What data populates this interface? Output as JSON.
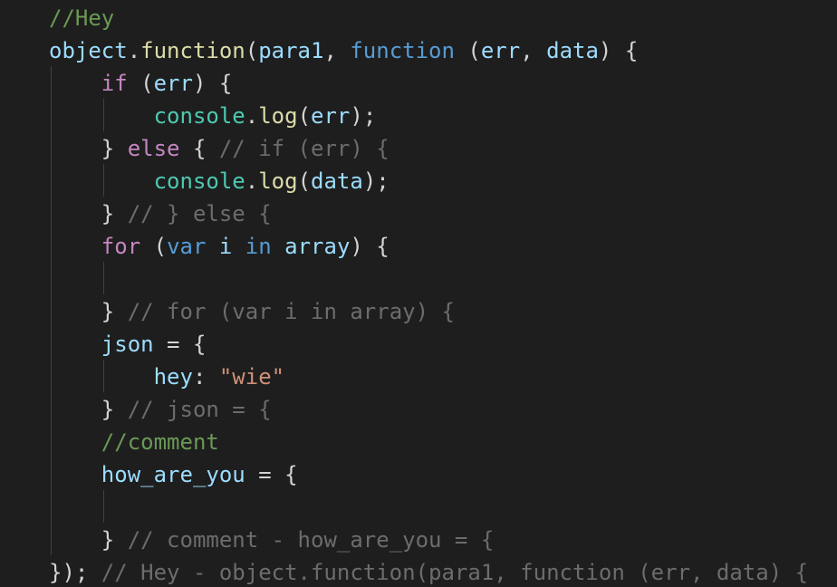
{
  "editor": {
    "lines": [
      {
        "tokens": [
          {
            "t": "//Hey",
            "c": "comment"
          }
        ]
      },
      {
        "tokens": [
          {
            "t": "object",
            "c": "variable"
          },
          {
            "t": ".",
            "c": "default"
          },
          {
            "t": "function",
            "c": "function"
          },
          {
            "t": "(",
            "c": "default"
          },
          {
            "t": "para1",
            "c": "variable"
          },
          {
            "t": ", ",
            "c": "default"
          },
          {
            "t": "function",
            "c": "keyword"
          },
          {
            "t": " (",
            "c": "default"
          },
          {
            "t": "err",
            "c": "variable"
          },
          {
            "t": ", ",
            "c": "default"
          },
          {
            "t": "data",
            "c": "variable"
          },
          {
            "t": ") {",
            "c": "default"
          }
        ]
      },
      {
        "tokens": [
          {
            "t": "    ",
            "c": "default"
          },
          {
            "t": "if",
            "c": "control"
          },
          {
            "t": " (",
            "c": "default"
          },
          {
            "t": "err",
            "c": "variable"
          },
          {
            "t": ") {",
            "c": "default"
          }
        ]
      },
      {
        "tokens": [
          {
            "t": "        ",
            "c": "default"
          },
          {
            "t": "console",
            "c": "class"
          },
          {
            "t": ".",
            "c": "default"
          },
          {
            "t": "log",
            "c": "function"
          },
          {
            "t": "(",
            "c": "default"
          },
          {
            "t": "err",
            "c": "variable"
          },
          {
            "t": ");",
            "c": "default"
          }
        ]
      },
      {
        "tokens": [
          {
            "t": "    } ",
            "c": "default"
          },
          {
            "t": "else",
            "c": "control"
          },
          {
            "t": " { ",
            "c": "default"
          },
          {
            "t": "// if (err) {",
            "c": "ghost"
          }
        ]
      },
      {
        "tokens": [
          {
            "t": "        ",
            "c": "default"
          },
          {
            "t": "console",
            "c": "class"
          },
          {
            "t": ".",
            "c": "default"
          },
          {
            "t": "log",
            "c": "function"
          },
          {
            "t": "(",
            "c": "default"
          },
          {
            "t": "data",
            "c": "variable"
          },
          {
            "t": ");",
            "c": "default"
          }
        ]
      },
      {
        "tokens": [
          {
            "t": "    } ",
            "c": "default"
          },
          {
            "t": "// } else {",
            "c": "ghost"
          }
        ]
      },
      {
        "tokens": [
          {
            "t": "    ",
            "c": "default"
          },
          {
            "t": "for",
            "c": "control"
          },
          {
            "t": " (",
            "c": "default"
          },
          {
            "t": "var",
            "c": "keyword"
          },
          {
            "t": " ",
            "c": "default"
          },
          {
            "t": "i",
            "c": "variable"
          },
          {
            "t": " ",
            "c": "default"
          },
          {
            "t": "in",
            "c": "keyword"
          },
          {
            "t": " ",
            "c": "default"
          },
          {
            "t": "array",
            "c": "variable"
          },
          {
            "t": ") {",
            "c": "default"
          }
        ]
      },
      {
        "tokens": []
      },
      {
        "tokens": [
          {
            "t": "    } ",
            "c": "default"
          },
          {
            "t": "// for (var i in array) {",
            "c": "ghost"
          }
        ]
      },
      {
        "tokens": [
          {
            "t": "    ",
            "c": "default"
          },
          {
            "t": "json",
            "c": "variable"
          },
          {
            "t": " = {",
            "c": "default"
          }
        ]
      },
      {
        "tokens": [
          {
            "t": "        ",
            "c": "default"
          },
          {
            "t": "hey",
            "c": "variable"
          },
          {
            "t": ": ",
            "c": "default"
          },
          {
            "t": "\"wie\"",
            "c": "string"
          }
        ]
      },
      {
        "tokens": [
          {
            "t": "    } ",
            "c": "default"
          },
          {
            "t": "// json = {",
            "c": "ghost"
          }
        ]
      },
      {
        "tokens": [
          {
            "t": "    ",
            "c": "default"
          },
          {
            "t": "//comment",
            "c": "comment"
          }
        ]
      },
      {
        "tokens": [
          {
            "t": "    ",
            "c": "default"
          },
          {
            "t": "how_are_you",
            "c": "variable"
          },
          {
            "t": " = {",
            "c": "default"
          }
        ]
      },
      {
        "tokens": []
      },
      {
        "tokens": [
          {
            "t": "    } ",
            "c": "default"
          },
          {
            "t": "// comment - how_are_you = {",
            "c": "ghost"
          }
        ]
      },
      {
        "tokens": [
          {
            "t": "}); ",
            "c": "default"
          },
          {
            "t": "// Hey - object.function(para1, function (err, data) {",
            "c": "ghost"
          }
        ]
      }
    ]
  }
}
